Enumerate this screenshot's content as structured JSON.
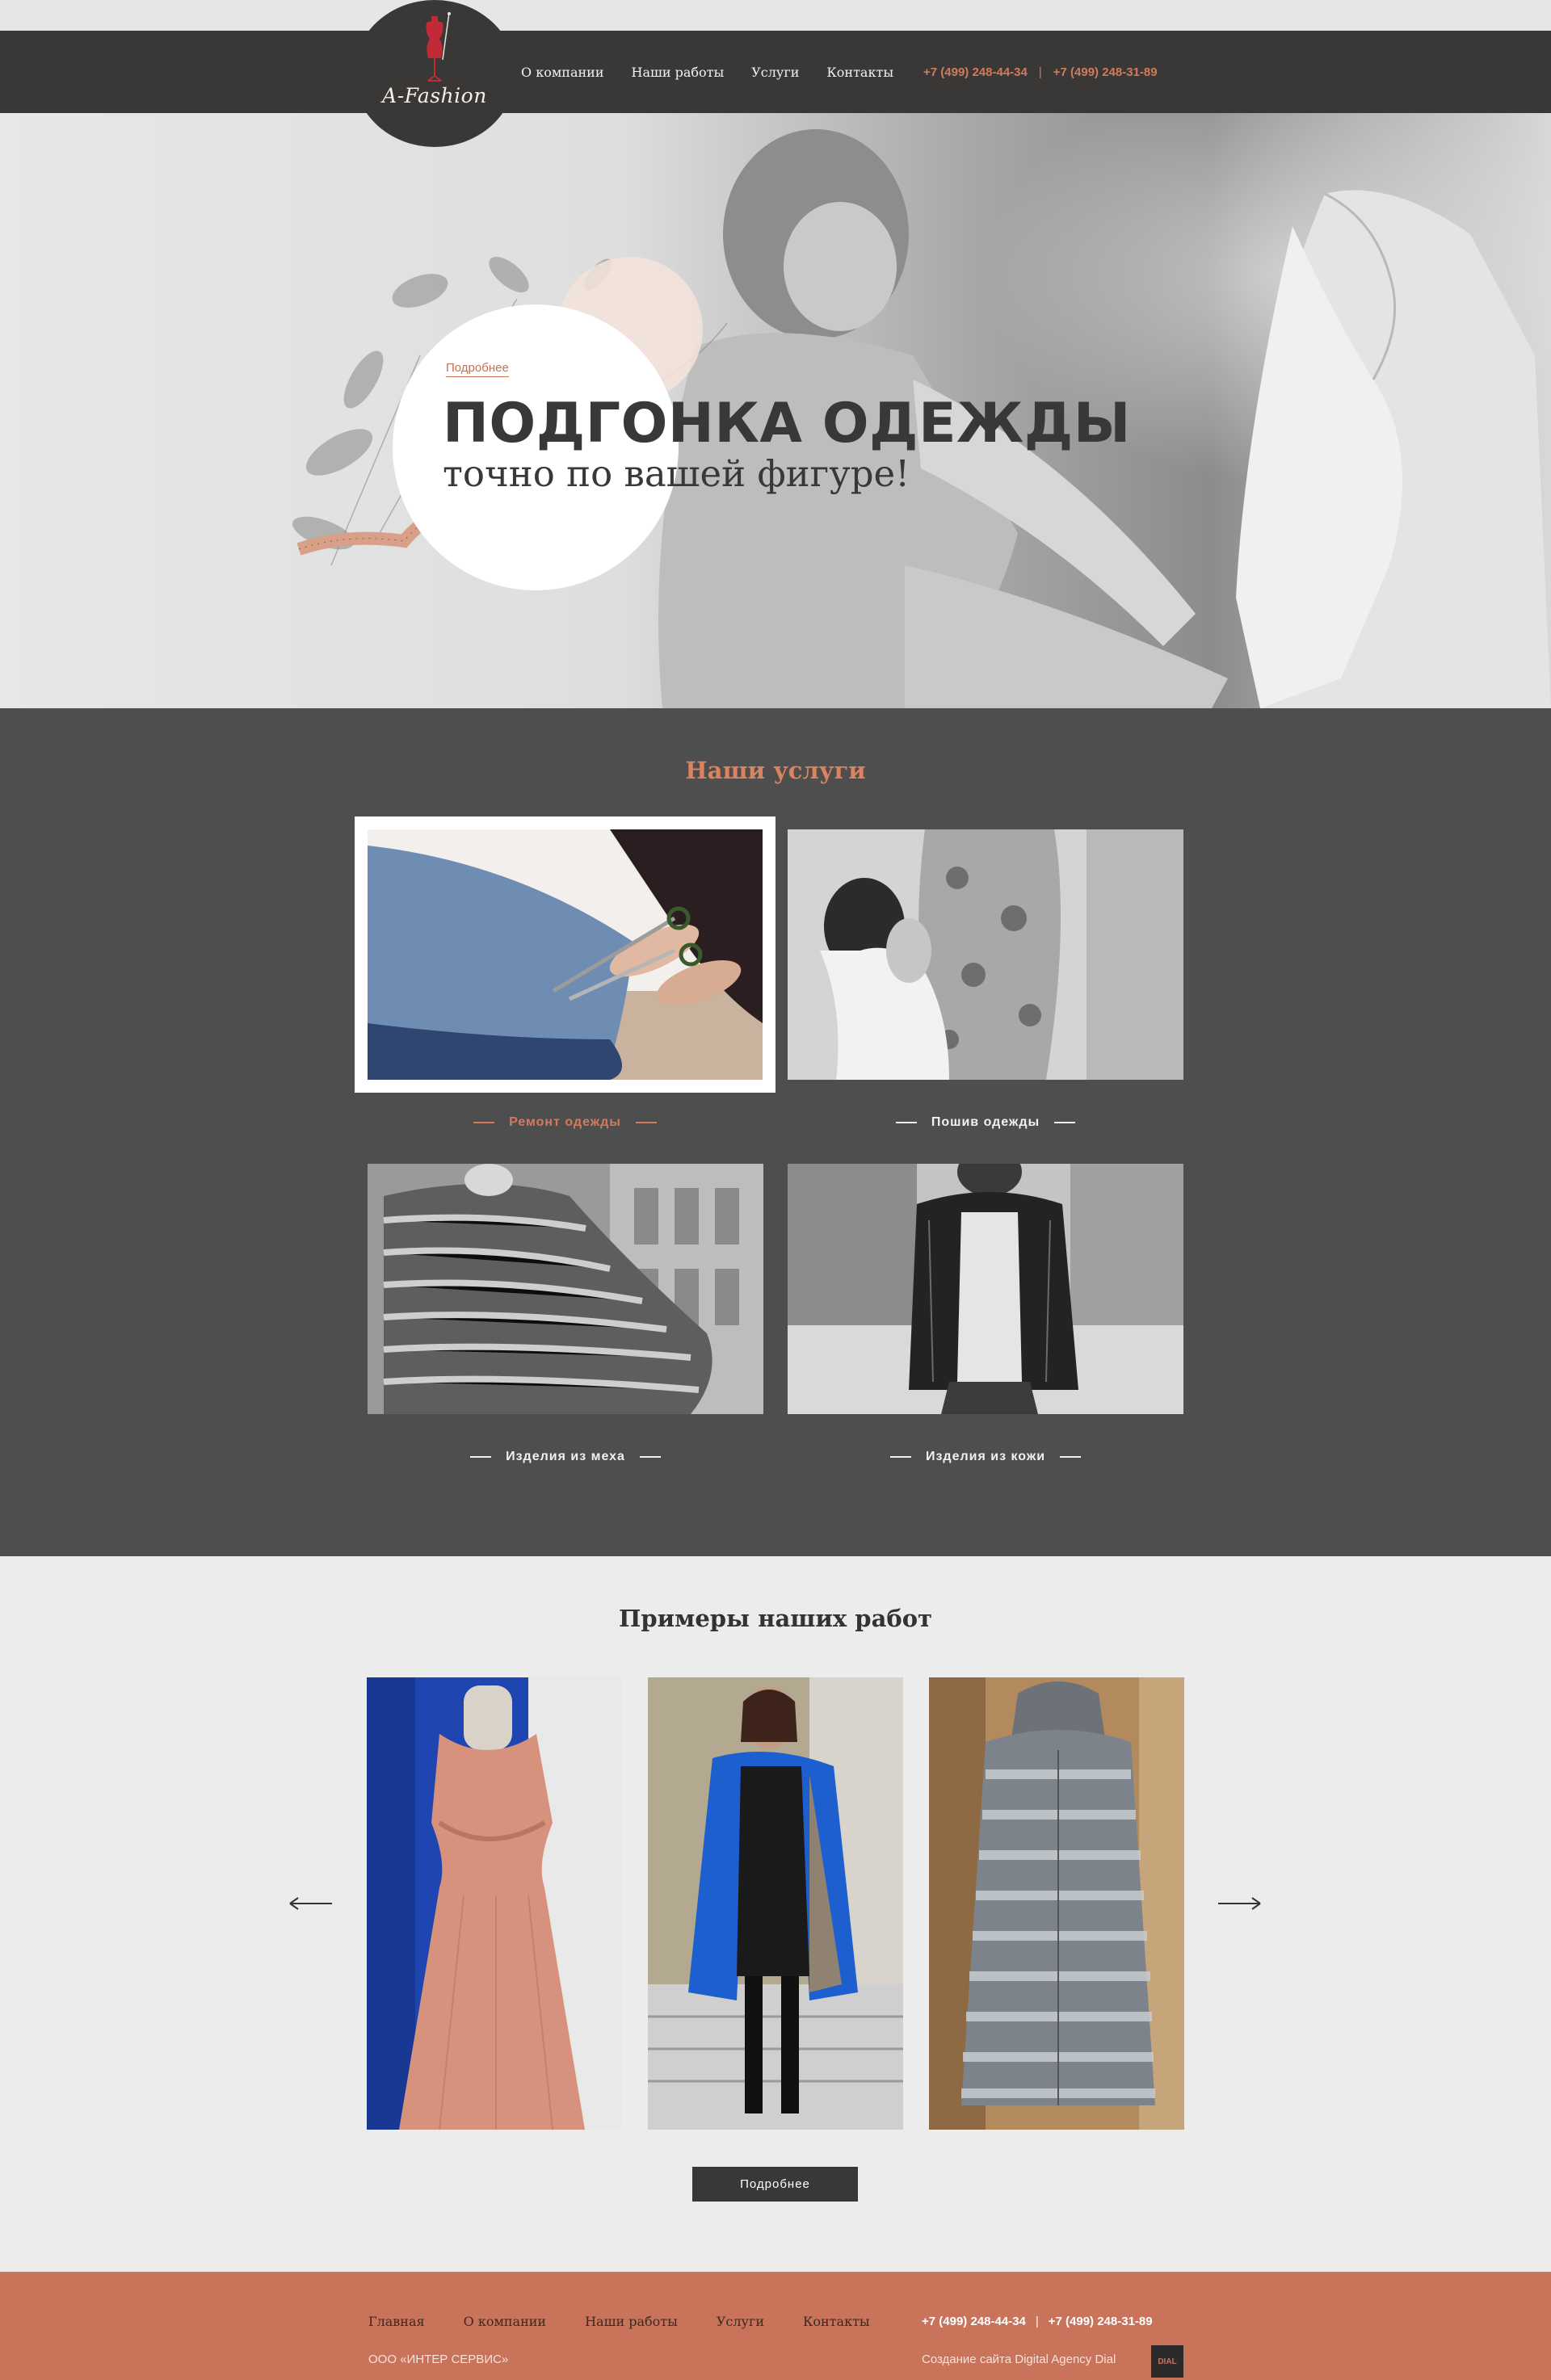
{
  "header": {
    "logo_text": "A-Fashion",
    "nav": [
      "О компании",
      "Наши работы",
      "Услуги",
      "Контакты"
    ],
    "phone1": "+7 (499) 248-44-34",
    "phone_sep": "|",
    "phone2": "+7 (499) 248-31-89"
  },
  "hero": {
    "more_link": "Подробнее",
    "title": "ПОДГОНКА ОДЕЖДЫ",
    "subtitle": "точно по вашей фигуре!"
  },
  "services": {
    "title": "Наши услуги",
    "items": [
      {
        "label": "Ремонт одежды"
      },
      {
        "label": "Пошив одежды"
      },
      {
        "label": "Изделия из меха"
      },
      {
        "label": "Изделия из кожи"
      }
    ]
  },
  "works": {
    "title": "Примеры наших работ",
    "button": "Подробнее"
  },
  "footer": {
    "nav": [
      "Главная",
      "О компании",
      "Наши работы",
      "Услуги",
      "Контакты"
    ],
    "phone1": "+7 (499) 248-44-34",
    "phone_sep": "|",
    "phone2": "+7 (499) 248-31-89",
    "company": "ООО «ИНТЕР СЕРВИС»",
    "credit": "Создание сайта Digital Agency Dial",
    "dial_logo": "DIAL"
  },
  "colors": {
    "accent": "#d37a5c",
    "dark": "#3a3837",
    "services_bg": "#4e4e4e",
    "footer_bg": "#c8735a"
  }
}
